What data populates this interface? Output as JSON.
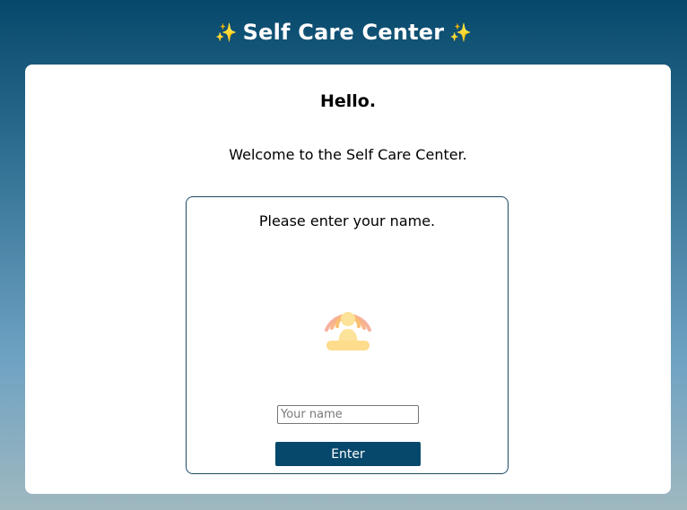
{
  "header": {
    "title": "Self Care Center",
    "sparkle_left": "✨",
    "sparkle_right": "✨"
  },
  "card": {
    "greeting": "Hello.",
    "welcome": "Welcome to the Self Care Center."
  },
  "login": {
    "prompt": "Please enter your name.",
    "icon": "meditation-icon",
    "name_input": {
      "value": "",
      "placeholder": "Your name"
    },
    "enter_label": "Enter"
  },
  "colors": {
    "accent": "#06486b",
    "border": "#1d4a66",
    "icon_body": "#fde29a",
    "icon_waves": "#f7a488"
  }
}
